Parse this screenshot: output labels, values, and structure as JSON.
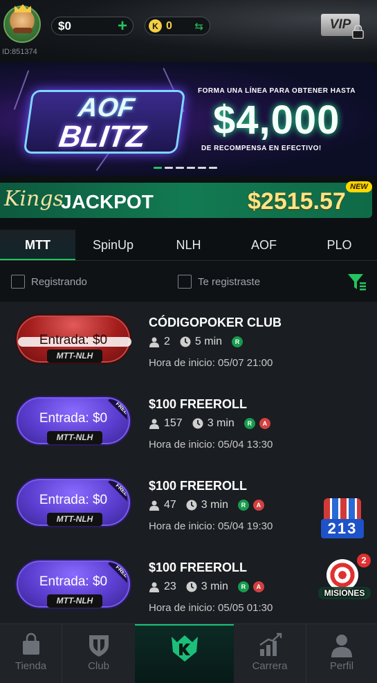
{
  "user": {
    "id_text": "ID:851374"
  },
  "wallet": {
    "cash": "$0",
    "cash_plus": "+",
    "k_symbol": "K",
    "k_coins": "0"
  },
  "vip": {
    "label": "VIP"
  },
  "banner": {
    "logo_line1": "AOF",
    "logo_line2": "BLITZ",
    "promo_top": "FORMA UNA LÍNEA PARA OBTENER HASTA",
    "promo_amount": "$4,000",
    "promo_bottom": "DE RECOMPENSA EN EFECTIVO!",
    "slides_total": 6,
    "active_slide": 1
  },
  "jackpot": {
    "kings": "Kings",
    "label": "JACKPOT",
    "amount": "$2515.57",
    "badge": "NEW"
  },
  "tabs": [
    {
      "label": "MTT",
      "active": true
    },
    {
      "label": "SpinUp",
      "active": false
    },
    {
      "label": "NLH",
      "active": false
    },
    {
      "label": "AOF",
      "active": false
    },
    {
      "label": "PLO",
      "active": false
    }
  ],
  "filters": {
    "registering": "Registrando",
    "registered": "Te registraste"
  },
  "tournaments": [
    {
      "entry": "Entrada: $0",
      "type": "MTT-NLH",
      "style": "red",
      "free": false,
      "title": "CÓDIGOPOKER CLUB",
      "players": "2",
      "duration": "5 min",
      "tags": [
        "R"
      ],
      "start": "Hora de inicio: 05/07 21:00"
    },
    {
      "entry": "Entrada: $0",
      "type": "MTT-NLH",
      "style": "purple",
      "free": true,
      "free_label": "FREE",
      "title": "$100 FREEROLL",
      "players": "157",
      "duration": "3 min",
      "tags": [
        "R",
        "A"
      ],
      "start": "Hora de inicio: 05/04 13:30"
    },
    {
      "entry": "Entrada: $0",
      "type": "MTT-NLH",
      "style": "purple",
      "free": true,
      "free_label": "FREE",
      "title": "$100 FREEROLL",
      "players": "47",
      "duration": "3 min",
      "tags": [
        "R",
        "A"
      ],
      "start": "Hora de inicio: 05/04 19:30"
    },
    {
      "entry": "Entrada: $0",
      "type": "MTT-NLH",
      "style": "purple",
      "free": true,
      "free_label": "FREE",
      "title": "$100 FREEROLL",
      "players": "23",
      "duration": "3 min",
      "tags": [
        "R",
        "A"
      ],
      "start": "Hora de inicio: 05/05 01:30"
    }
  ],
  "widgets": {
    "game_213": "213",
    "missions": "MISIONES",
    "missions_count": "2"
  },
  "nav": [
    {
      "label": "Tienda",
      "icon": "shopping-bag-icon"
    },
    {
      "label": "Club",
      "icon": "shield-icon"
    },
    {
      "label": "",
      "icon": "kings-logo-icon",
      "active": true
    },
    {
      "label": "Carrera",
      "icon": "trophy-chart-icon"
    },
    {
      "label": "Perfil",
      "icon": "user-icon"
    }
  ],
  "colors": {
    "accent": "#22c55e",
    "gold": "#f5d142",
    "jackpot_bg": "#127a52",
    "entry_red": "#a31d1d",
    "entry_purple": "#5b3ed0"
  }
}
